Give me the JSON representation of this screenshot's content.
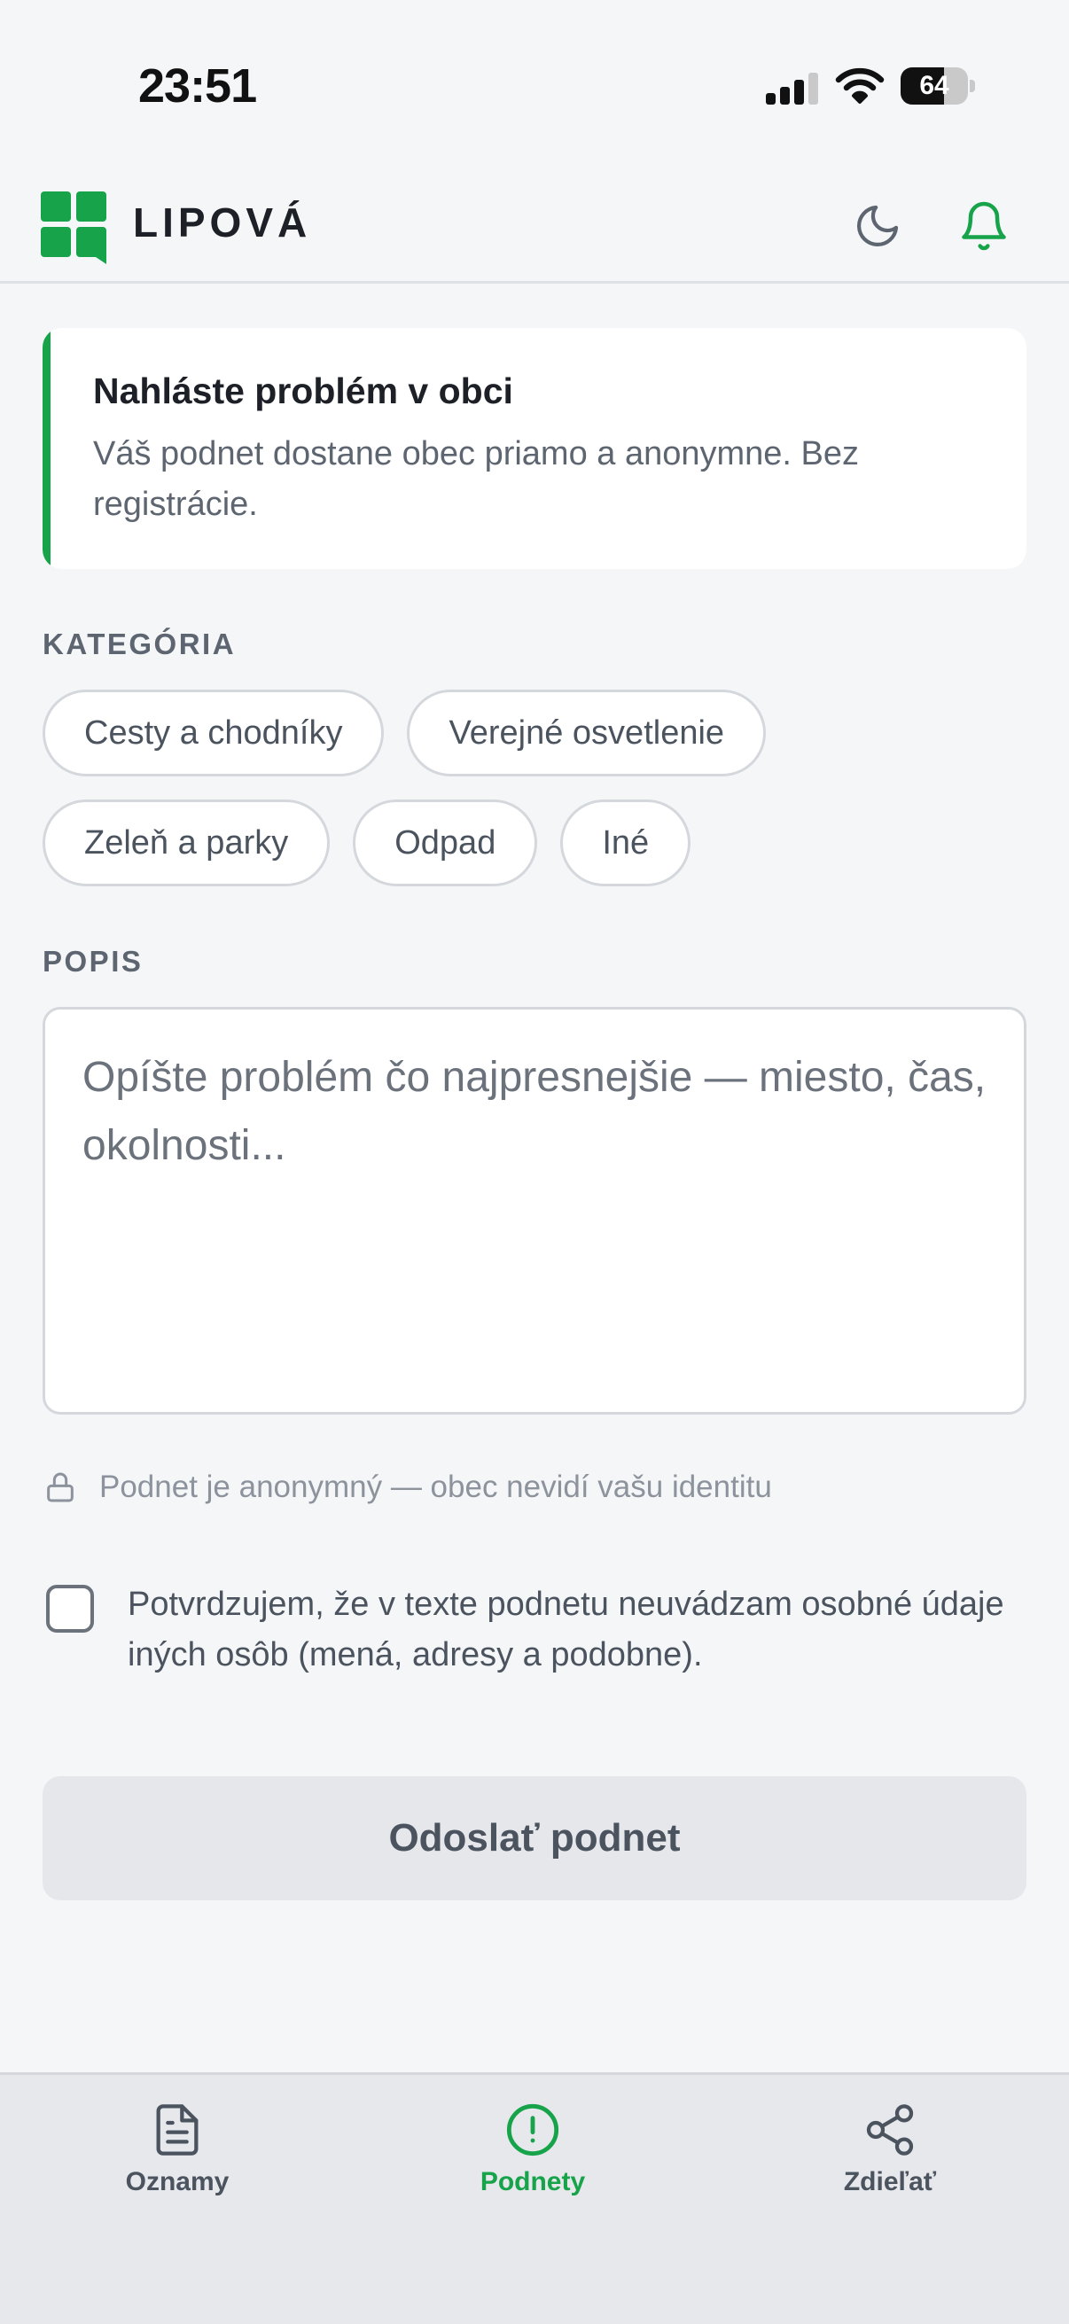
{
  "status_bar": {
    "time": "23:51",
    "battery_level": "64",
    "battery_fraction": 0.64,
    "signal_bars": 4,
    "signal_bars_active": 3
  },
  "header": {
    "brand": "LIPOVÁ",
    "moon_icon": "moon-icon",
    "bell_icon": "bell-icon",
    "accent_color": "#16a34a"
  },
  "notice": {
    "title": "Nahláste problém v obci",
    "text": "Váš podnet dostane obec priamo a anonymne. Bez registrácie."
  },
  "category": {
    "label": "KATEGÓRIA",
    "chips_row1": [
      "Cesty a chodníky",
      "Verejné osvetlenie"
    ],
    "chips_row2": [
      "Zeleň a parky",
      "Odpad",
      "Iné"
    ]
  },
  "description": {
    "label": "POPIS",
    "placeholder": "Opíšte problém čo najpresnejšie — miesto, čas, okolnosti...",
    "value": ""
  },
  "anonymity_note": "Podnet je anonymný — obec nevidí vašu identitu",
  "consent": {
    "text": "Potvrdzujem, že v texte podnetu neuvádzam osobné údaje iných osôb (mená, adresy a podobne).",
    "checked": false
  },
  "submit_label": "Odoslať podnet",
  "bottom_nav": {
    "items": [
      {
        "label": "Oznamy",
        "icon": "document-icon",
        "active": false
      },
      {
        "label": "Podnety",
        "icon": "alert-circle-icon",
        "active": true
      },
      {
        "label": "Zdieľať",
        "icon": "share-icon",
        "active": false
      }
    ]
  }
}
